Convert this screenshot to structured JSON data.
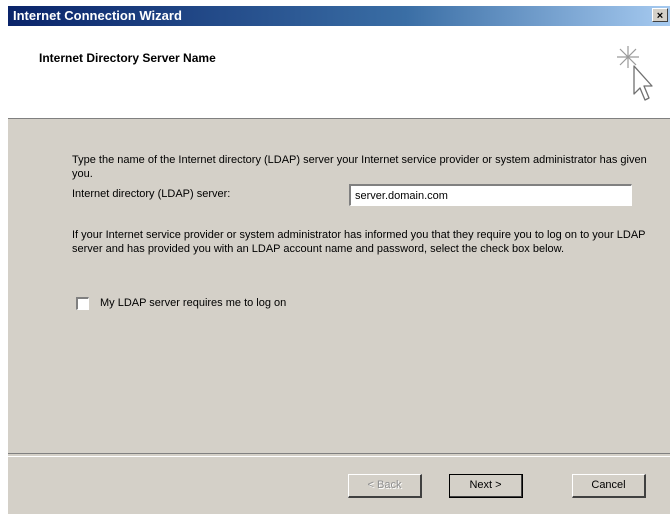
{
  "window": {
    "title": "Internet Connection Wizard",
    "close_glyph": "×"
  },
  "header": {
    "title": "Internet Directory Server Name",
    "icon": "wizard-cursor-sparkle-icon"
  },
  "content": {
    "intro": "Type the name of the Internet directory (LDAP) server your Internet service provider or system administrator has given you.",
    "ldap_label": "Internet directory (LDAP) server:",
    "ldap_value": "server.domain.com",
    "info": "If your Internet service provider or system administrator has informed you that they require you to log on to your LDAP server and has provided you with an LDAP account name and password, select the check box below.",
    "checkbox_label": "My LDAP server requires me to log on",
    "checkbox_checked": false
  },
  "buttons": {
    "back": "< Back",
    "next": "Next >",
    "cancel": "Cancel"
  },
  "colors": {
    "face": "#d4d0c8",
    "title_start": "#0a246a",
    "title_end": "#a6caf0"
  }
}
